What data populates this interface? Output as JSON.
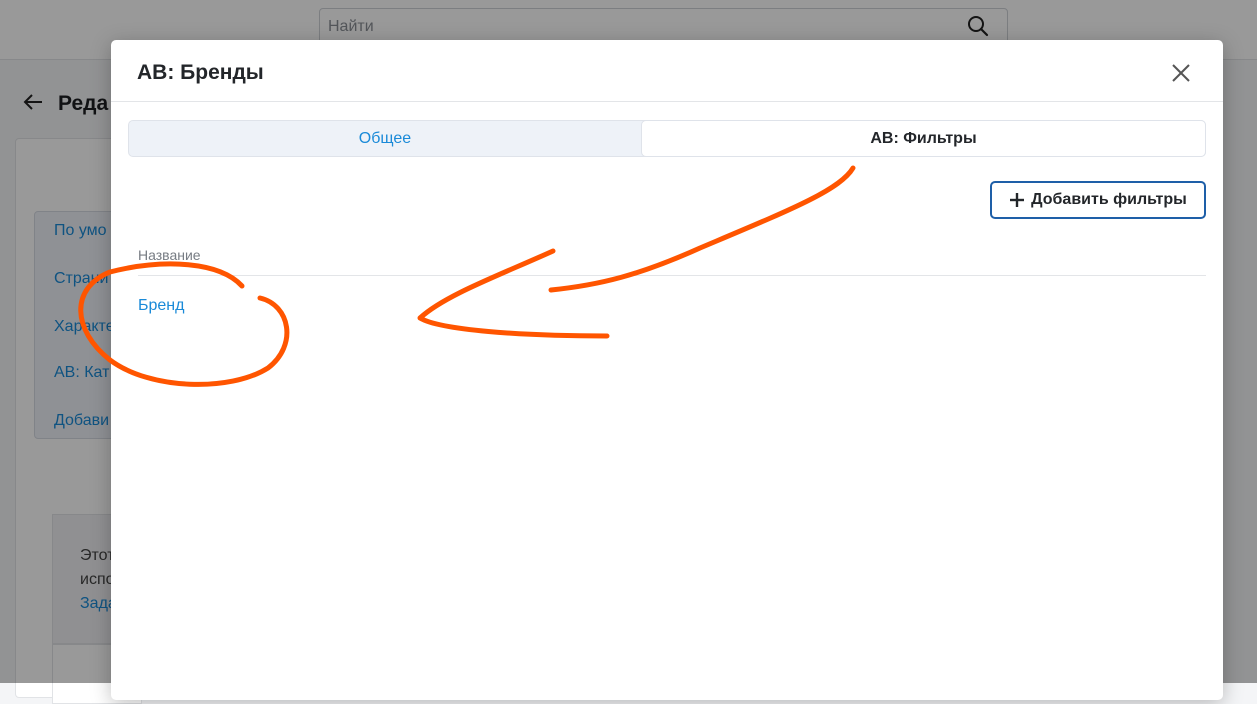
{
  "background": {
    "search_placeholder": "Найти",
    "page_title": "Реда",
    "menu_items": [
      "По умо",
      "Страни",
      "Характе",
      "АВ: Кат",
      "Добави"
    ],
    "note_lines": [
      "Этот",
      "испо"
    ],
    "note_link": "Зада"
  },
  "modal": {
    "title": "АВ: Бренды",
    "tabs": [
      {
        "label": "Общее",
        "active": false
      },
      {
        "label": "АВ: Фильтры",
        "active": true
      }
    ],
    "add_button_label": "Добавить фильтры",
    "table": {
      "columns": [
        "Название"
      ],
      "rows": [
        {
          "name": "Бренд"
        }
      ]
    }
  },
  "annotation": {
    "color": "#ff5500",
    "shapes": [
      "circle",
      "arrow"
    ]
  },
  "colors": {
    "link": "#1a8ad8",
    "button_border": "#1e5fa8"
  }
}
